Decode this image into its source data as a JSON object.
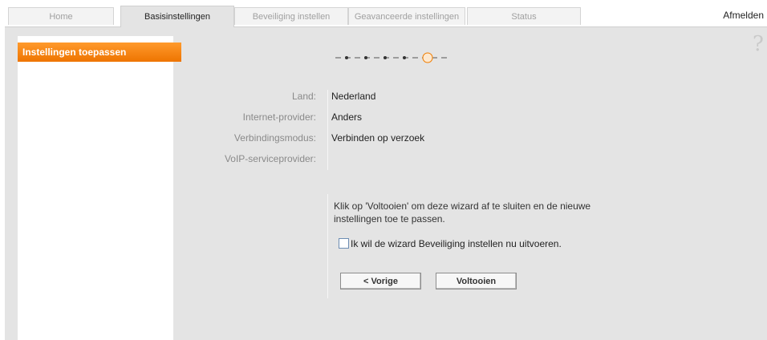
{
  "tabs": [
    {
      "label": "Home"
    },
    {
      "label": "Basisinstellingen"
    },
    {
      "label": "Beveiliging instellen"
    },
    {
      "label": "Geavanceerde instellingen"
    },
    {
      "label": "Status"
    }
  ],
  "active_tab": "Basisinstellingen",
  "logout_label": "Afmelden",
  "help_icon": "?",
  "sidebar": {
    "items": [
      {
        "label": "Instellingen toepassen",
        "selected": true
      }
    ]
  },
  "wizard": {
    "total_steps": 5,
    "current_step": 5,
    "accent_color": "#f07d00"
  },
  "summary": [
    {
      "label": "Land:",
      "value": "Nederland"
    },
    {
      "label": "Internet-provider:",
      "value": "Anders"
    },
    {
      "label": "Verbindingsmodus:",
      "value": "Verbinden op verzoek"
    },
    {
      "label": "VoIP-serviceprovider:",
      "value": ""
    }
  ],
  "info_text": "Klik op 'Voltooien' om deze wizard af te sluiten en de nieuwe instellingen toe te passen.",
  "checkbox": {
    "label": "Ik wil de wizard Beveiliging instellen nu uitvoeren.",
    "checked": false
  },
  "buttons": {
    "back": "< Vorige",
    "finish": "Voltooien"
  }
}
